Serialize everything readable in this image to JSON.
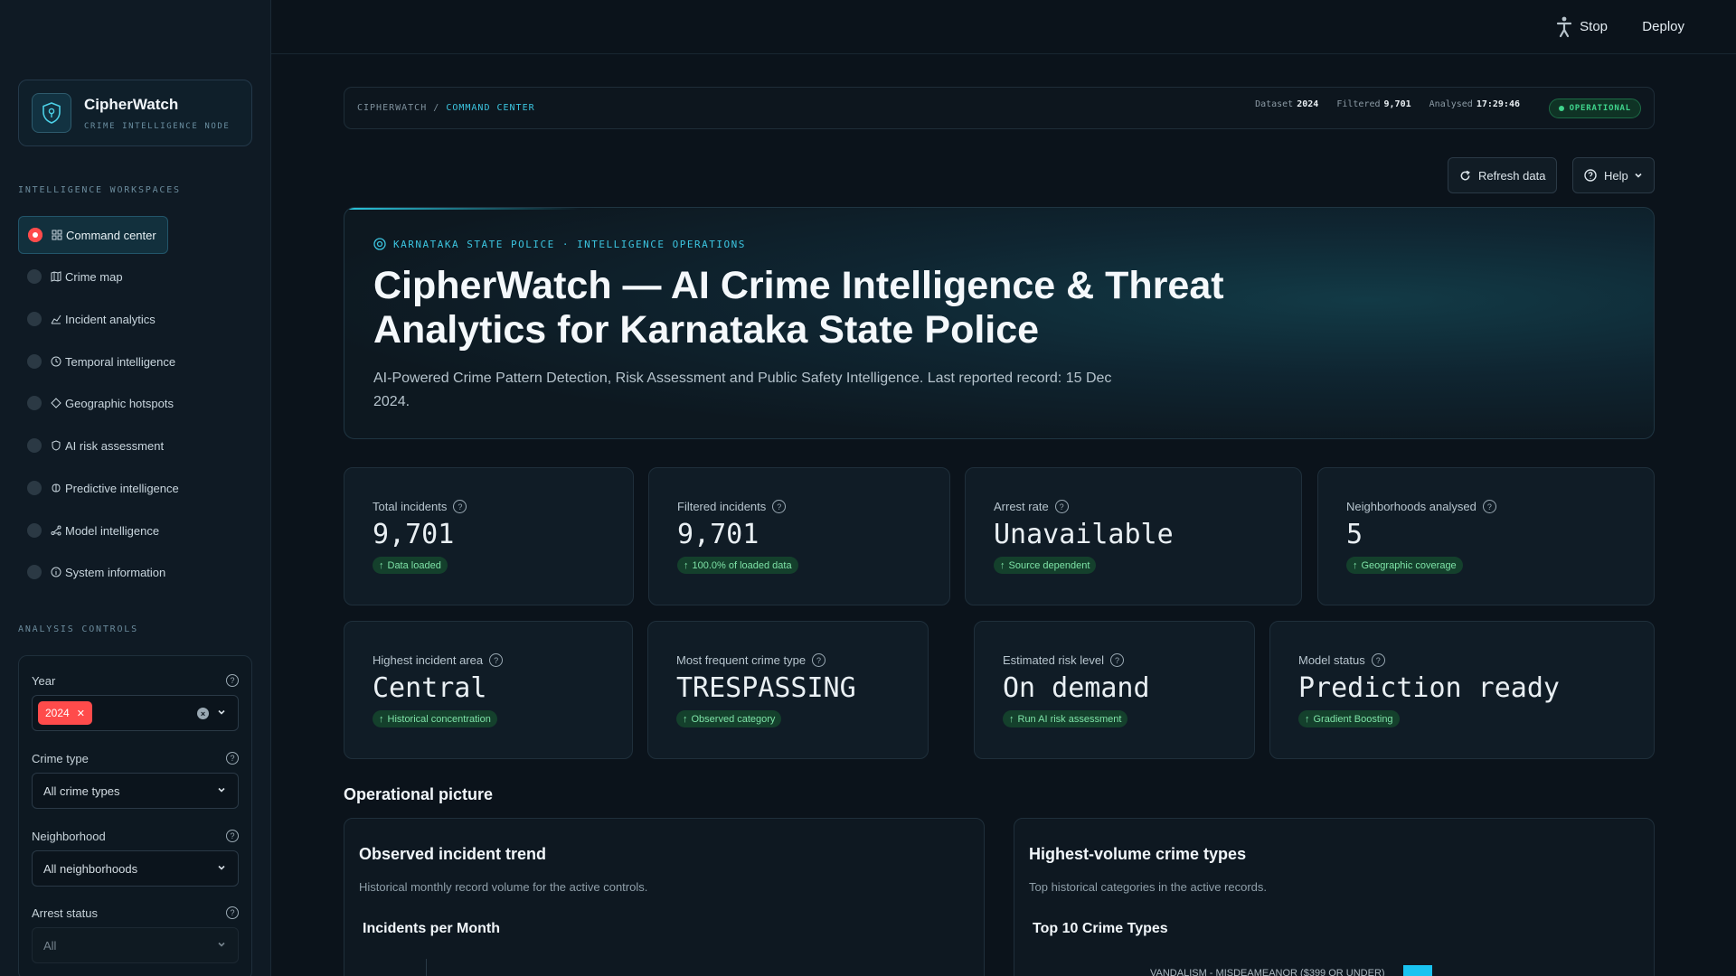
{
  "topbar": {
    "stop_label": "Stop",
    "deploy_label": "Deploy",
    "running_icon": "running-man-icon"
  },
  "brand": {
    "title": "CipherWatch",
    "subtitle": "CRIME INTELLIGENCE NODE",
    "logo_icon": "shield-icon"
  },
  "sidebar": {
    "workspaces_label": "INTELLIGENCE WORKSPACES",
    "items": [
      {
        "label": "Command center",
        "icon": "grid-icon",
        "active": true
      },
      {
        "label": "Crime map",
        "icon": "map-icon"
      },
      {
        "label": "Incident analytics",
        "icon": "chart-icon"
      },
      {
        "label": "Temporal intelligence",
        "icon": "clock-icon"
      },
      {
        "label": "Geographic hotspots",
        "icon": "pin-icon"
      },
      {
        "label": "AI risk assessment",
        "icon": "shield-icon"
      },
      {
        "label": "Predictive intelligence",
        "icon": "brain-icon"
      },
      {
        "label": "Model intelligence",
        "icon": "nodes-icon"
      },
      {
        "label": "System information",
        "icon": "info-icon"
      }
    ],
    "controls_label": "ANALYSIS CONTROLS"
  },
  "controls": {
    "year": {
      "label": "Year",
      "selected": "2024"
    },
    "crime_type": {
      "label": "Crime type",
      "value": "All crime types"
    },
    "neighborhood": {
      "label": "Neighborhood",
      "value": "All neighborhoods"
    },
    "arrest_status": {
      "label": "Arrest status",
      "value": "All"
    },
    "help_glyph": "?"
  },
  "header": {
    "crumb_root": "CIPHERWATCH",
    "crumb_sep": "/",
    "crumb_current": "COMMAND CENTER",
    "dataset_label": "Dataset",
    "dataset_value": "2024",
    "filtered_label": "Filtered",
    "filtered_value": "9,701",
    "analysed_label": "Analysed",
    "analysed_value": "17:29:46",
    "status": "OPERATIONAL",
    "status_color": "#3fd48c"
  },
  "actions": {
    "refresh_label": "Refresh data",
    "help_label": "Help"
  },
  "hero": {
    "kicker": "KARNATAKA STATE POLICE · INTELLIGENCE OPERATIONS",
    "title": "CipherWatch — AI Crime Intelligence & Threat Analytics for Karnataka State Police",
    "subtitle": "AI-Powered Crime Pattern Detection, Risk Assessment and Public Safety Intelligence. Last reported record: 15 Dec 2024."
  },
  "kpis": [
    {
      "label": "Total incidents",
      "value": "9,701",
      "delta": "Data loaded"
    },
    {
      "label": "Filtered incidents",
      "value": "9,701",
      "delta": "100.0% of loaded data"
    },
    {
      "label": "Arrest rate",
      "value": "Unavailable",
      "delta": "Source dependent"
    },
    {
      "label": "Neighborhoods analysed",
      "value": "5",
      "delta": "Geographic coverage"
    },
    {
      "label": "Highest incident area",
      "value": "Central",
      "delta": "Historical concentration"
    },
    {
      "label": "Most frequent crime type",
      "value": "TRESPASSING",
      "delta": "Observed category"
    },
    {
      "label": "Estimated risk level",
      "value": "On demand",
      "delta": "Run AI risk assessment"
    },
    {
      "label": "Model status",
      "value": "Prediction ready",
      "delta": "Gradient Boosting"
    }
  ],
  "operational": {
    "title": "Operational picture",
    "trend": {
      "title": "Observed incident trend",
      "desc": "Historical monthly record volume for the active controls.",
      "chart_title": "Incidents per Month"
    },
    "types": {
      "title": "Highest-volume crime types",
      "desc": "Top historical categories in the active records.",
      "chart_title": "Top 10 Crime Types",
      "first_bar_label": "VANDALISM - MISDEAMEANOR ($399 OR UNDER)",
      "bar_color": "#19c3f0"
    }
  }
}
